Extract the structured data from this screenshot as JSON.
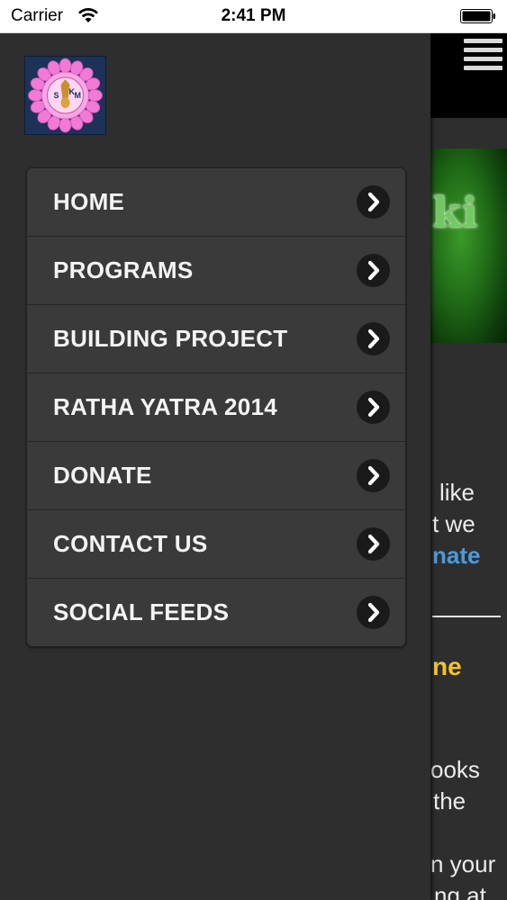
{
  "status_bar": {
    "carrier": "Carrier",
    "time": "2:41 PM"
  },
  "menu": {
    "items": [
      {
        "label": "HOME",
        "icon": "chevron-right-icon"
      },
      {
        "label": "PROGRAMS",
        "icon": "chevron-right-icon"
      },
      {
        "label": "BUILDING PROJECT",
        "icon": "chevron-right-icon"
      },
      {
        "label": "RATHA YATRA 2014",
        "icon": "chevron-right-icon"
      },
      {
        "label": "DONATE",
        "icon": "chevron-right-icon"
      },
      {
        "label": "CONTACT US",
        "icon": "chevron-right-icon"
      },
      {
        "label": "SOCIAL FEEDS",
        "icon": "chevron-right-icon"
      }
    ]
  },
  "logo": {
    "letters": [
      "S",
      "K",
      "M"
    ]
  },
  "background_page": {
    "banner_text": "ki",
    "text_lines": [
      "like",
      "t we",
      "nate",
      "ne",
      "ooks",
      "the",
      "n your",
      "ng at"
    ]
  },
  "colors": {
    "drawer_bg": "#2e2e2e",
    "menu_bg": "#3a3a3a",
    "link_blue": "#4b9bdc",
    "heading_yellow": "#f3c32c",
    "logo_petal_pink": "#f07ad6"
  }
}
